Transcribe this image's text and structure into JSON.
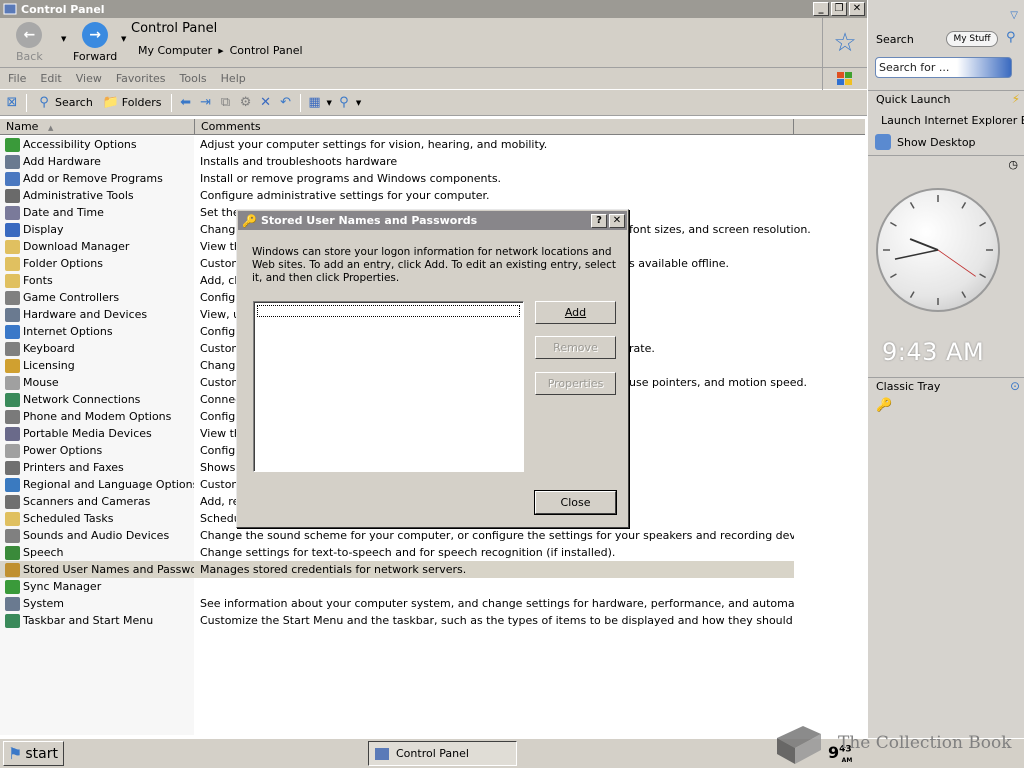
{
  "window": {
    "title": "Control Panel",
    "controls": [
      "_",
      "❐",
      "✕"
    ]
  },
  "nav": {
    "back_label": "Back",
    "forward_label": "Forward",
    "location_title": "Control Panel",
    "breadcrumb": [
      "My Computer",
      "Control Panel"
    ]
  },
  "menu": [
    "File",
    "Edit",
    "View",
    "Favorites",
    "Tools",
    "Help"
  ],
  "toolbar": {
    "search_label": "Search",
    "folders_label": "Folders"
  },
  "columns": {
    "name": "Name",
    "comments": "Comments"
  },
  "items": [
    {
      "name": "Accessibility Options",
      "comment": "Adjust your computer settings for vision, hearing, and mobility.",
      "color": "#3a9a3a"
    },
    {
      "name": "Add Hardware",
      "comment": "Installs and troubleshoots hardware",
      "color": "#6a7a90"
    },
    {
      "name": "Add or Remove Programs",
      "comment": "Install or remove programs and Windows components.",
      "color": "#4a78c0"
    },
    {
      "name": "Administrative Tools",
      "comment": "Configure administrative settings for your computer.",
      "color": "#6a6a6a"
    },
    {
      "name": "Date and Time",
      "comment": "Set the",
      "color": "#7a7a9a"
    },
    {
      "name": "Display",
      "comment": "Change",
      "comment2": "font sizes, and screen resolution.",
      "color": "#3a6ac0"
    },
    {
      "name": "Download Manager",
      "comment": "View th",
      "color": "#e0c060"
    },
    {
      "name": "Folder Options",
      "comment": "Custom",
      "comment2": "s available offline.",
      "color": "#e0c060"
    },
    {
      "name": "Fonts",
      "comment": "Add, ch",
      "color": "#e0c060"
    },
    {
      "name": "Game Controllers",
      "comment": "Configu",
      "color": "#808080"
    },
    {
      "name": "Hardware and Devices",
      "comment": "View, u",
      "color": "#6a7a90"
    },
    {
      "name": "Internet Options",
      "comment": "Configu",
      "color": "#3a78c8"
    },
    {
      "name": "Keyboard",
      "comment": "Custom",
      "comment2": "rate.",
      "color": "#808080"
    },
    {
      "name": "Licensing",
      "comment": "Change",
      "color": "#d0a030"
    },
    {
      "name": "Mouse",
      "comment": "Custom",
      "comment2": "use pointers, and motion speed.",
      "color": "#a0a0a0"
    },
    {
      "name": "Network Connections",
      "comment": "Connec",
      "color": "#3a8a5a"
    },
    {
      "name": "Phone and Modem Options",
      "comment": "Configu",
      "color": "#7a7a7a"
    },
    {
      "name": "Portable Media Devices",
      "comment": "View th",
      "color": "#6a6a8a"
    },
    {
      "name": "Power Options",
      "comment": "Configu",
      "color": "#a0a0a0"
    },
    {
      "name": "Printers and Faxes",
      "comment": "Shows",
      "color": "#707070"
    },
    {
      "name": "Regional and Language Options",
      "comment": "Custom",
      "color": "#3a7ac0"
    },
    {
      "name": "Scanners and Cameras",
      "comment": "Add, re",
      "color": "#707070"
    },
    {
      "name": "Scheduled Tasks",
      "comment": "Schedu",
      "color": "#e0c060"
    },
    {
      "name": "Sounds and Audio Devices",
      "comment": "Change the sound scheme for your computer, or configure the settings for your speakers and recording devices.",
      "color": "#808080"
    },
    {
      "name": "Speech",
      "comment": "Change settings for text-to-speech and for speech recognition (if installed).",
      "color": "#3a8a3a"
    },
    {
      "name": "Stored User Names and Passwords",
      "comment": "Manages stored credentials for network servers.",
      "color": "#c09030",
      "selected": true
    },
    {
      "name": "Sync Manager",
      "comment": "",
      "color": "#3a9a3a"
    },
    {
      "name": "System",
      "comment": "See information about your computer system, and change settings for hardware, performance, and automatic updates.",
      "color": "#6a7a90"
    },
    {
      "name": "Taskbar and Start Menu",
      "comment": "Customize the Start Menu and the taskbar, such as the types of items to be displayed and how they should appear.",
      "color": "#3a8a5a"
    }
  ],
  "dialog": {
    "title": "Stored User Names and Passwords",
    "help": "?",
    "close_x": "✕",
    "description": "Windows can store your logon information for network locations and Web sites. To add an entry, click Add. To edit an existing entry, select it, and then click Properties.",
    "add_label": "Add",
    "remove_label": "Remove",
    "properties_label": "Properties",
    "close_label": "Close"
  },
  "sidebar": {
    "search_label": "Search",
    "mystuff_label": "My Stuff",
    "search_placeholder": "Search for ...",
    "quick_launch_title": "Quick Launch",
    "quick_launch_items": [
      "Launch Internet Explorer Browser",
      "Show Desktop"
    ],
    "clock_time": "9:43 AM",
    "classic_tray_title": "Classic Tray"
  },
  "taskbar": {
    "start_label": "start",
    "task_label": "Control Panel",
    "tray_hour": "9",
    "tray_minute": "43",
    "tray_ampm": "AM",
    "watermark": "The Collection Book"
  },
  "colors": {
    "dialog_title": "#88868a",
    "window_title": "#9c9a94",
    "accent": "#3a78c8"
  }
}
